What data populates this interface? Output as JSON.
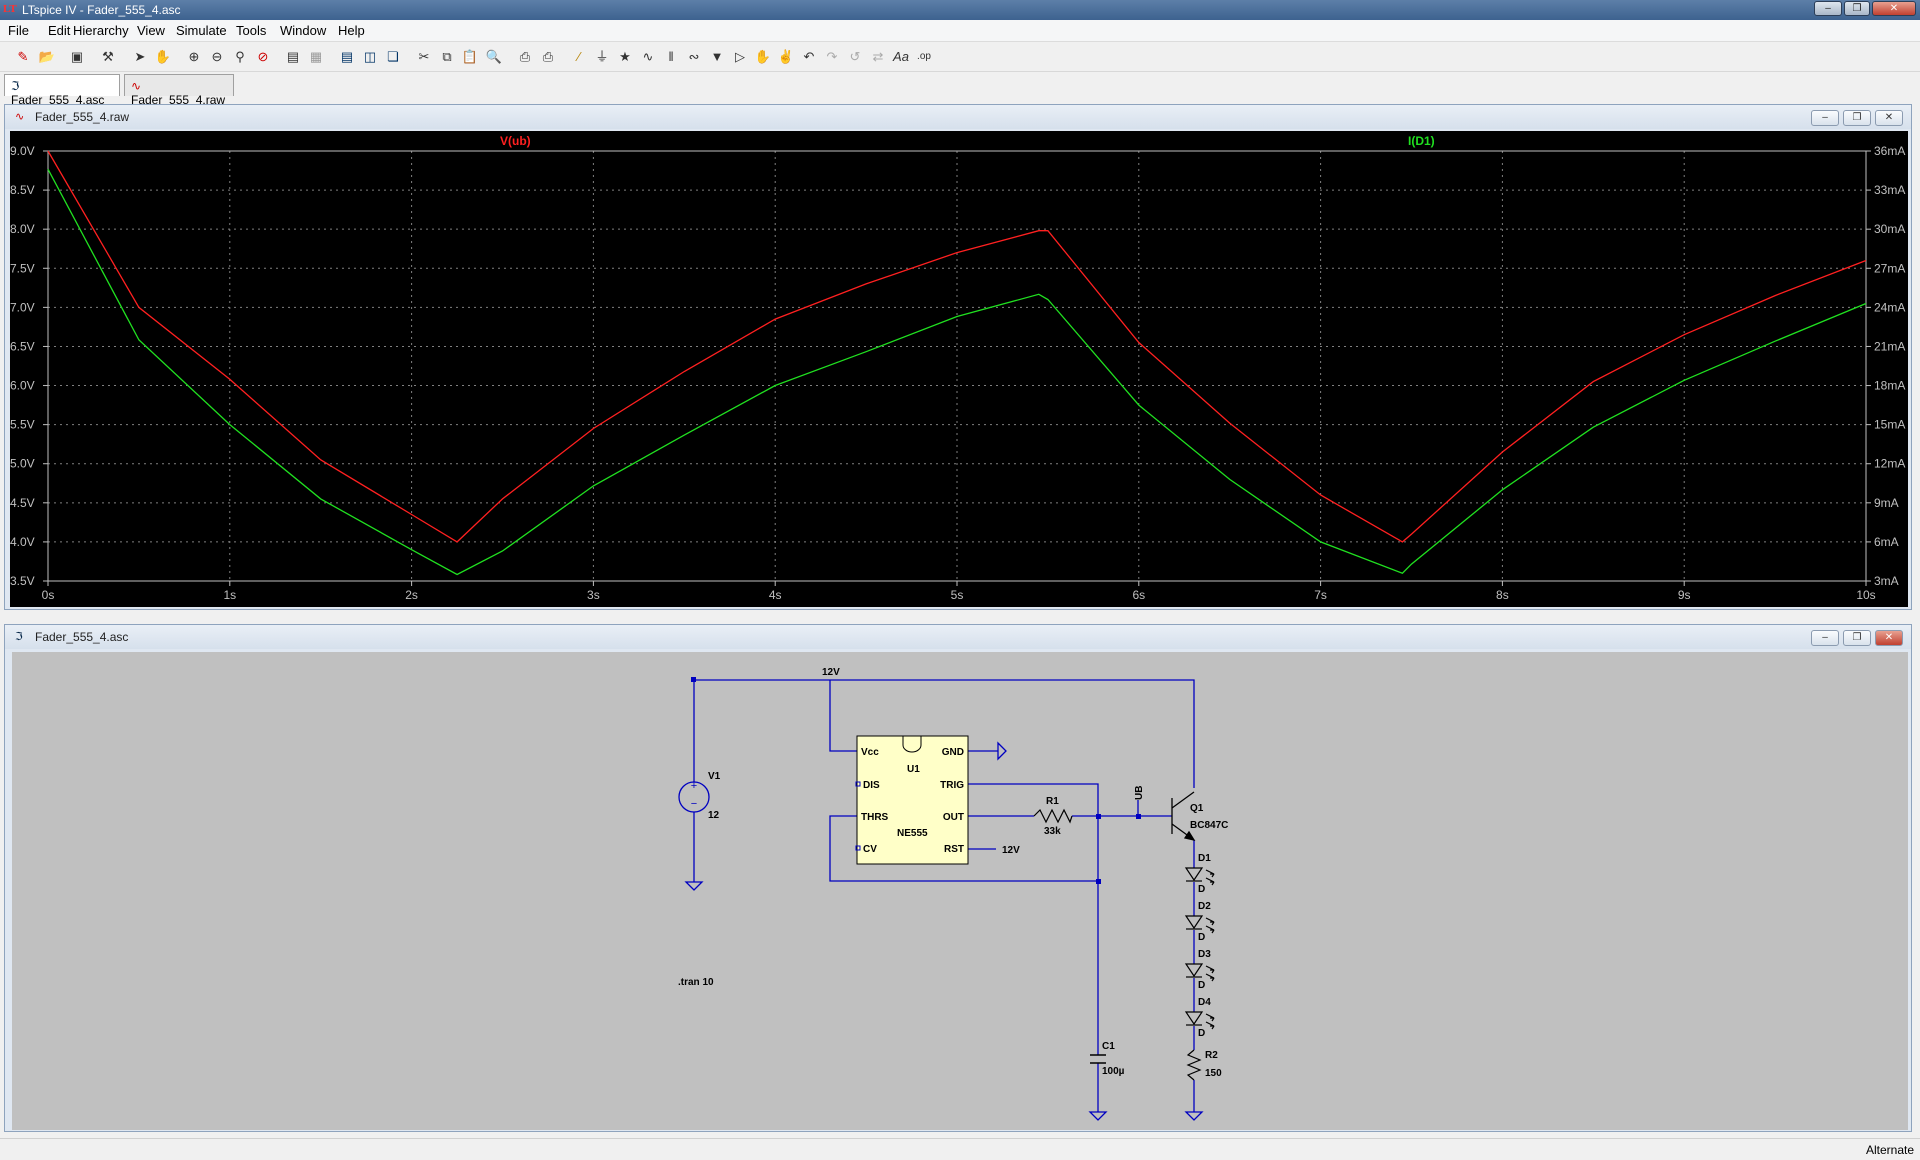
{
  "window": {
    "title": "LTspice IV - Fader_555_4.asc",
    "app_icon": "LT"
  },
  "menu": [
    "File",
    "Edit",
    "Hierarchy",
    "View",
    "Simulate",
    "Tools",
    "Window",
    "Help"
  ],
  "toolbar_icons": [
    "new-schematic-icon",
    "open-icon",
    "save-icon",
    "control-panel-icon",
    "run-icon",
    "halt-icon",
    "zoom-in-icon",
    "zoom-out-icon",
    "zoom-fit-icon",
    "zoom-cancel-icon",
    "autorange-icon",
    "edit-attributes-icon",
    "tile-horizontal-icon",
    "tile-vertical-icon",
    "cascade-icon",
    "cut-icon",
    "copy-icon",
    "paste-icon",
    "find-icon",
    "print-preview-icon",
    "print-icon",
    "draw-wire-icon",
    "ground-icon",
    "label-net-icon",
    "resistor-icon",
    "capacitor-icon",
    "inductor-icon",
    "diode-icon",
    "component-icon",
    "move-icon",
    "drag-icon",
    "undo-icon",
    "redo-icon",
    "rotate-icon",
    "mirror-icon",
    "text-icon",
    "spice-directive-icon"
  ],
  "tabs": [
    {
      "label": "Fader_555_4.asc",
      "icon": "schematic-icon"
    },
    {
      "label": "Fader_555_4.raw",
      "icon": "waveform-icon"
    }
  ],
  "plot_window": {
    "title": "Fader_555_4.raw"
  },
  "schematic_window": {
    "title": "Fader_555_4.asc"
  },
  "status": {
    "text": "Alternate"
  },
  "chart_data": {
    "type": "line",
    "x": [
      0,
      0.5,
      1,
      1.5,
      2,
      2.25,
      2.5,
      3,
      3.5,
      4,
      4.5,
      5,
      5.45,
      5.5,
      6,
      6.5,
      7,
      7.45,
      7.5,
      8,
      8.5,
      9,
      9.5,
      10
    ],
    "series": [
      {
        "name": "V(ub)",
        "color": "#ff2020",
        "axis": "left",
        "values": [
          9.0,
          7.0,
          6.08,
          5.05,
          4.35,
          4.0,
          4.55,
          5.45,
          6.18,
          6.85,
          7.3,
          7.7,
          7.98,
          7.98,
          6.55,
          5.52,
          4.6,
          4.0,
          4.1,
          5.15,
          6.05,
          6.65,
          7.15,
          7.6
        ]
      },
      {
        "name": "I(D1)",
        "color": "#20e020",
        "axis": "right",
        "values": [
          34.6,
          21.5,
          15.0,
          9.3,
          5.4,
          3.5,
          5.3,
          10.3,
          14.2,
          18.0,
          20.6,
          23.3,
          25.0,
          24.6,
          16.5,
          10.8,
          6.0,
          3.6,
          4.3,
          10.0,
          14.8,
          18.4,
          21.4,
          24.3
        ]
      }
    ],
    "x_ticks": [
      "0s",
      "1s",
      "2s",
      "3s",
      "4s",
      "5s",
      "6s",
      "7s",
      "8s",
      "9s",
      "10s"
    ],
    "y_left_ticks": [
      "9.0V",
      "8.5V",
      "8.0V",
      "7.5V",
      "7.0V",
      "6.5V",
      "6.0V",
      "5.5V",
      "5.0V",
      "4.5V",
      "4.0V",
      "3.5V"
    ],
    "y_right_ticks": [
      "36mA",
      "33mA",
      "30mA",
      "27mA",
      "24mA",
      "21mA",
      "18mA",
      "15mA",
      "12mA",
      "9mA",
      "6mA",
      "3mA"
    ],
    "xlim": [
      0,
      10
    ],
    "ylim_left": [
      3.5,
      9.0
    ],
    "ylim_right": [
      3,
      36
    ],
    "grid": true,
    "background": "#000000"
  },
  "schematic": {
    "net_12v_top": "12V",
    "net_12v_rst": "12V",
    "net_ub": "UB",
    "v1": {
      "name": "V1",
      "value": "12"
    },
    "u1": {
      "name": "U1",
      "part": "NE555",
      "pins": {
        "vcc": "Vcc",
        "gnd": "GND",
        "dis": "DIS",
        "trig": "TRIG",
        "thrs": "THRS",
        "out": "OUT",
        "cv": "CV",
        "rst": "RST"
      }
    },
    "r1": {
      "name": "R1",
      "value": "33k"
    },
    "q1": {
      "name": "Q1",
      "part": "BC847C"
    },
    "d1": {
      "name": "D1",
      "part": "D"
    },
    "d2": {
      "name": "D2",
      "part": "D"
    },
    "d3": {
      "name": "D3",
      "part": "D"
    },
    "d4": {
      "name": "D4",
      "part": "D"
    },
    "r2": {
      "name": "R2",
      "value": "150"
    },
    "c1": {
      "name": "C1",
      "value": "100µ"
    },
    "directive": ".tran 10"
  }
}
